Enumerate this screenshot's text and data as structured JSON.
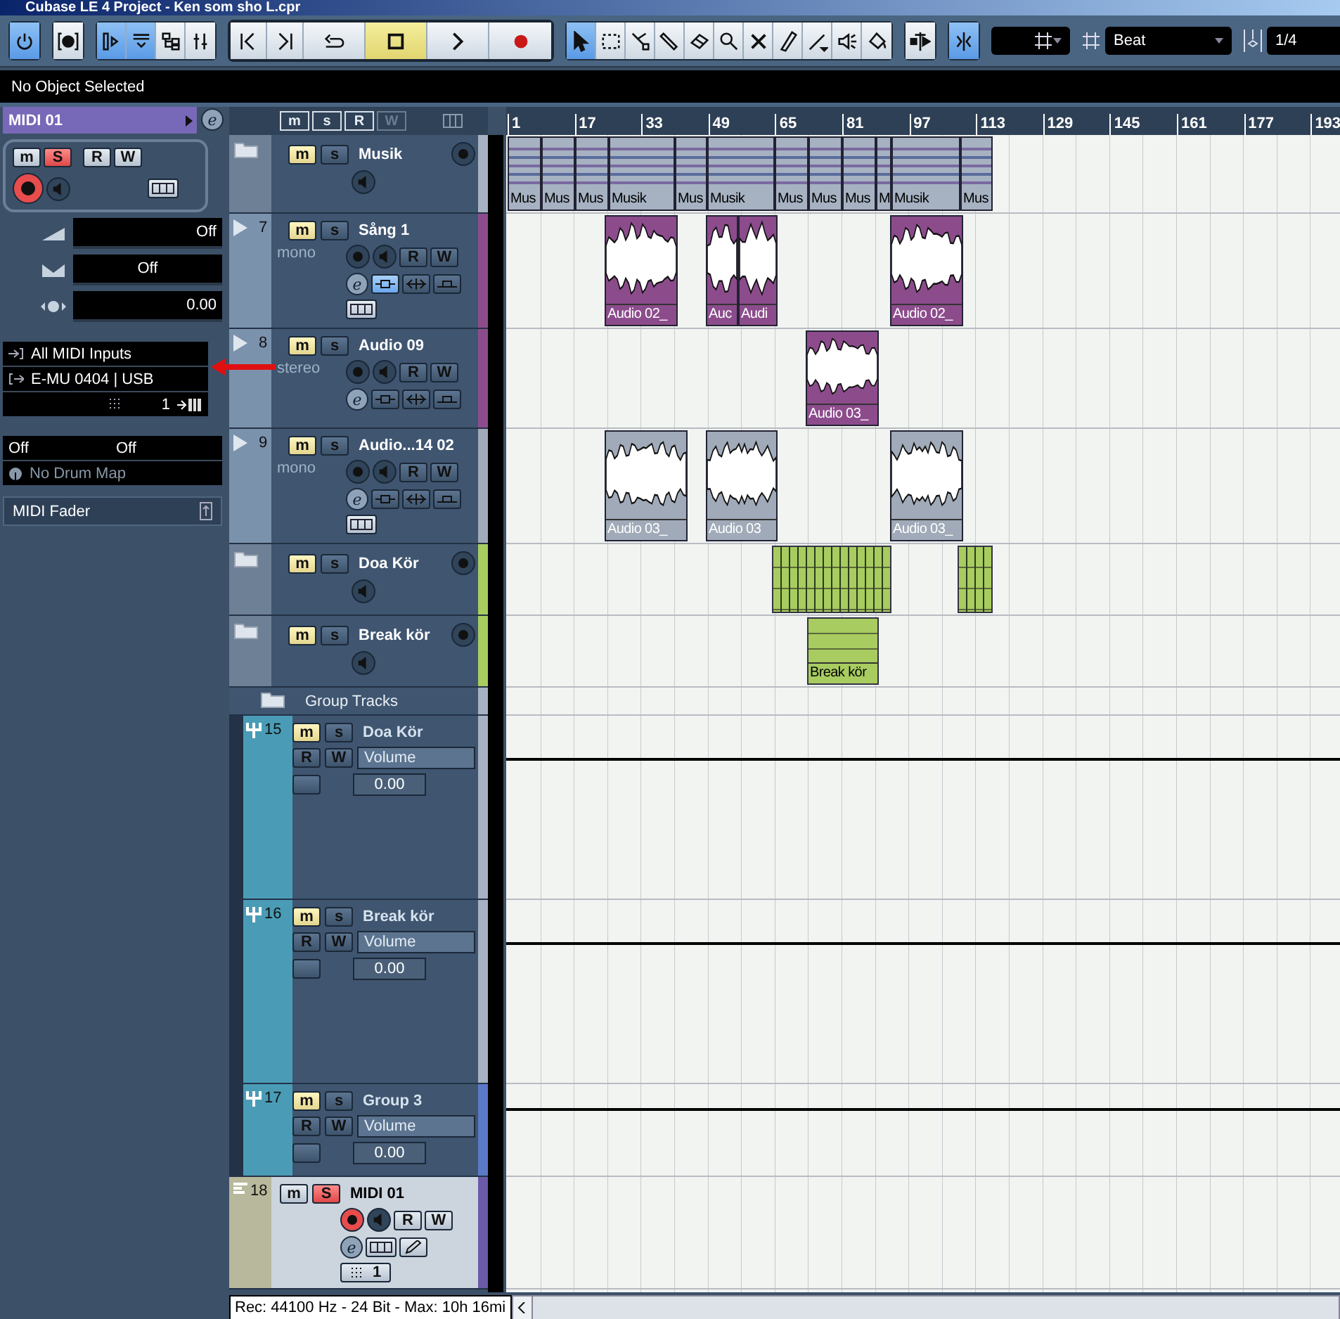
{
  "window": {
    "title": "Cubase LE 4 Project - Ken som sho L.cpr"
  },
  "toolbar": [
    {
      "kind": "toggles",
      "buttons": [
        {
          "kind": "power",
          "on": true
        }
      ]
    },
    {
      "kind": "toggles",
      "buttons": [
        {
          "kind": "constrain",
          "on": false
        }
      ]
    },
    {
      "kind": "toggles",
      "buttons": [
        {
          "kind": "inspector",
          "on": true
        },
        {
          "kind": "overview",
          "on": true
        },
        {
          "kind": "pool",
          "on": false
        },
        {
          "kind": "mixer",
          "on": false
        }
      ]
    },
    {
      "kind": "transport",
      "buttons": [
        {
          "kind": "prev",
          "on": false
        },
        {
          "kind": "next",
          "on": false
        },
        {
          "kind": "cycle",
          "on": false
        },
        {
          "kind": "stop",
          "on": true
        },
        {
          "kind": "play",
          "on": false
        },
        {
          "kind": "record",
          "on": false
        }
      ]
    },
    {
      "kind": "toggles",
      "buttons": [
        {
          "kind": "pointer",
          "on": true
        },
        {
          "kind": "range",
          "on": false
        },
        {
          "kind": "split",
          "on": false
        },
        {
          "kind": "glue",
          "on": false
        },
        {
          "kind": "erase",
          "on": false
        },
        {
          "kind": "zoom",
          "on": false
        },
        {
          "kind": "mute",
          "on": false
        },
        {
          "kind": "draw",
          "on": false
        },
        {
          "kind": "line",
          "on": false
        },
        {
          "kind": "speaker",
          "on": false
        },
        {
          "kind": "color",
          "on": false
        }
      ]
    },
    {
      "kind": "toggles",
      "buttons": [
        {
          "kind": "autoscroll",
          "on": false
        }
      ]
    },
    {
      "kind": "toggles",
      "buttons": [
        {
          "kind": "snap",
          "on": true
        }
      ]
    }
  ],
  "grid": {
    "value": "Beat"
  },
  "quantize": {
    "value": "1/4"
  },
  "info_line": "No Object Selected",
  "inspector": {
    "track_name": "MIDI 01",
    "edit": "e",
    "mute": "m",
    "solo": "S",
    "read": "R",
    "write": "W",
    "muted": false,
    "soloed": true,
    "record_enabled": true,
    "volume": "Off",
    "pan": "Off",
    "delay": "0.00",
    "input": "All MIDI Inputs",
    "output": "E-MU 0404 | USB",
    "channel": "1",
    "bank": "Off",
    "program": "Off",
    "drum_map": "No Drum Map",
    "section": "MIDI Fader"
  },
  "track_header": {
    "mute": "m",
    "solo": "s",
    "read": "R",
    "write": "W"
  },
  "ruler": {
    "bars": [
      "1",
      "17",
      "33",
      "49",
      "65",
      "81",
      "97",
      "113",
      "129",
      "145",
      "161",
      "177",
      "193"
    ]
  },
  "tracks": [
    {
      "kind": "folder",
      "name": "Musik",
      "color": "#a6b2c2",
      "selected": false,
      "muted": true,
      "soloed": false,
      "record_enabled": false,
      "labels": {
        "mute": "m",
        "solo": "s"
      },
      "events": [
        {
          "kind": "folder",
          "label": "Mus"
        },
        {
          "kind": "folder",
          "label": "Mus"
        },
        {
          "kind": "folder",
          "label": "Mus"
        },
        {
          "kind": "folder",
          "label": "Musik"
        },
        {
          "kind": "folder",
          "label": "Mus"
        },
        {
          "kind": "folder",
          "label": "Musik"
        },
        {
          "kind": "folder",
          "label": "Mus"
        },
        {
          "kind": "folder",
          "label": "Mus"
        },
        {
          "kind": "folder",
          "label": "Mus"
        },
        {
          "kind": "folder",
          "label": "M"
        },
        {
          "kind": "folder",
          "label": "Musik"
        },
        {
          "kind": "folder",
          "label": "Mus"
        }
      ]
    },
    {
      "kind": "audio",
      "number": "7",
      "name": "Sång 1",
      "channels": "mono",
      "color": "#8c4c8c",
      "selected": false,
      "muted": true,
      "soloed": false,
      "record_enabled": false,
      "insert_on": true,
      "show_lanes": true,
      "labels": {
        "mute": "m",
        "solo": "s",
        "read": "R",
        "write": "W",
        "edit": "e"
      },
      "events": [
        {
          "kind": "audio",
          "label": "Audio 02_"
        },
        {
          "kind": "audio",
          "label": "Auc"
        },
        {
          "kind": "audio",
          "label": "Audi"
        },
        {
          "kind": "audio",
          "label": "Audio 02_"
        }
      ]
    },
    {
      "kind": "audio",
      "number": "8",
      "name": "Audio 09",
      "channels": "stereo",
      "color": "#8c4c8c",
      "selected": false,
      "muted": true,
      "soloed": false,
      "record_enabled": false,
      "insert_on": false,
      "show_lanes": false,
      "labels": {
        "mute": "m",
        "solo": "s",
        "read": "R",
        "write": "W",
        "edit": "e"
      },
      "events": [
        {
          "kind": "audio",
          "label": "Audio 03_"
        }
      ]
    },
    {
      "kind": "audio",
      "number": "9",
      "name": "Audio...14 02",
      "channels": "mono",
      "color": "#a0aab8",
      "selected": false,
      "muted": true,
      "soloed": false,
      "record_enabled": false,
      "insert_on": false,
      "show_lanes": true,
      "labels": {
        "mute": "m",
        "solo": "s",
        "read": "R",
        "write": "W",
        "edit": "e"
      },
      "events": [
        {
          "kind": "audio",
          "label": "Audio 03_"
        },
        {
          "kind": "audio",
          "label": "Audio 03"
        },
        {
          "kind": "audio",
          "label": "Audio 03_"
        }
      ]
    },
    {
      "kind": "folder",
      "name": "Doa Kör",
      "color": "#a8cc60",
      "selected": false,
      "muted": true,
      "soloed": false,
      "record_enabled": false,
      "labels": {
        "mute": "m",
        "solo": "s"
      },
      "events": [
        {
          "kind": "parts"
        },
        {
          "kind": "parts"
        }
      ]
    },
    {
      "kind": "folder",
      "name": "Break kör",
      "color": "#a8cc60",
      "selected": false,
      "muted": true,
      "soloed": false,
      "record_enabled": false,
      "labels": {
        "mute": "m",
        "solo": "s"
      },
      "events": [
        {
          "kind": "parts",
          "label": "Break kör"
        }
      ]
    },
    {
      "kind": "group_folder",
      "name": "Group Tracks",
      "color": "#a6b2c2",
      "selected": false
    },
    {
      "kind": "group",
      "number": "15",
      "name": "Doa Kör",
      "color": "#a6b2c2",
      "selected": false,
      "muted": true,
      "soloed": false,
      "automation": "Volume",
      "value": "0.00",
      "labels": {
        "mute": "m",
        "solo": "s",
        "read": "R",
        "write": "W"
      }
    },
    {
      "kind": "group",
      "number": "16",
      "name": "Break kör",
      "color": "#a6b2c2",
      "selected": false,
      "muted": true,
      "soloed": false,
      "automation": "Volume",
      "value": "0.00",
      "labels": {
        "mute": "m",
        "solo": "s",
        "read": "R",
        "write": "W"
      }
    },
    {
      "kind": "group",
      "number": "17",
      "name": "Group 3",
      "color": "#5a7ac8",
      "selected": false,
      "muted": true,
      "soloed": false,
      "automation": "Volume",
      "value": "0.00",
      "labels": {
        "mute": "m",
        "solo": "s",
        "read": "R",
        "write": "W"
      }
    },
    {
      "kind": "midi",
      "number": "18",
      "name": "MIDI 01",
      "color": "#6a5aa8",
      "selected": true,
      "muted": false,
      "soloed": true,
      "record_enabled": true,
      "channel": "1",
      "labels": {
        "mute": "m",
        "solo": "S",
        "read": "R",
        "write": "W",
        "edit": "e"
      }
    }
  ],
  "status_bar": {
    "text": "Rec: 44100 Hz - 24 Bit - Max: 10h 16mi"
  }
}
